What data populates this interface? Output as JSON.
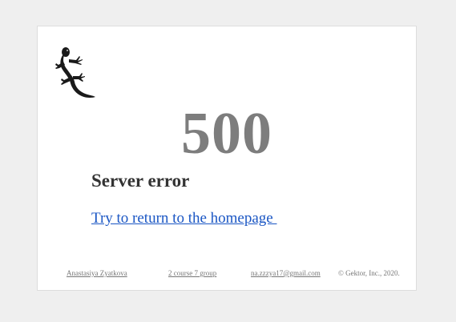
{
  "logo": {
    "icon": "lizard-icon",
    "color": "#1a1a1a"
  },
  "error": {
    "code": "500",
    "title": "Server error"
  },
  "home_link": {
    "label": "Try to return to the homepage "
  },
  "footer": {
    "author": "Anastasiya Zyatkova",
    "group": "2 course 7 group",
    "email": "na.zzzya17@gmail.com",
    "copyright": "© Gektor, Inc., 2020."
  },
  "colors": {
    "page_background": "#efefef",
    "card_background": "#ffffff",
    "code_color": "#7d7d7d",
    "title_color": "#333333",
    "link_color": "#1a56c4",
    "footer_color": "#777777"
  }
}
